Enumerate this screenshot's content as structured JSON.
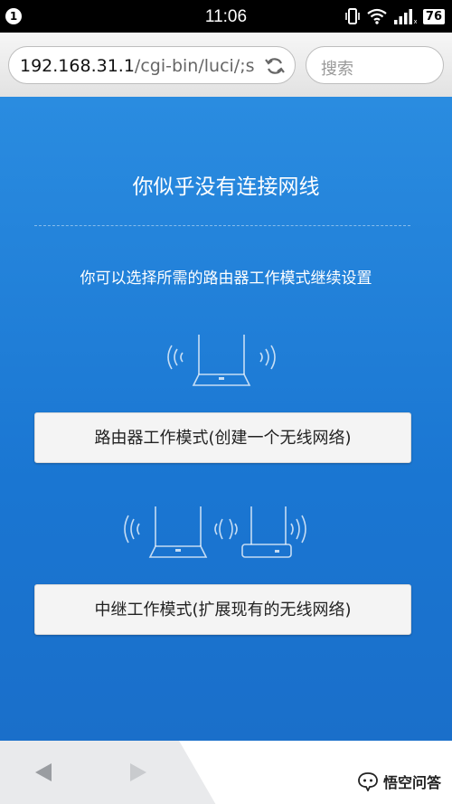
{
  "status_bar": {
    "notification_badge": "1",
    "time": "11:06",
    "battery": "76"
  },
  "address_bar": {
    "url_host": "192.168.31.1",
    "url_path": "/cgi-bin/luci/;s",
    "search_placeholder": "搜索"
  },
  "page": {
    "title": "你似乎没有连接网线",
    "hint": "你可以选择所需的路由器工作模式继续设置",
    "router_mode_button": "路由器工作模式(创建一个无线网络)",
    "relay_mode_button": "中继工作模式(扩展现有的无线网络)"
  },
  "watermark": {
    "text": "悟空问答"
  }
}
